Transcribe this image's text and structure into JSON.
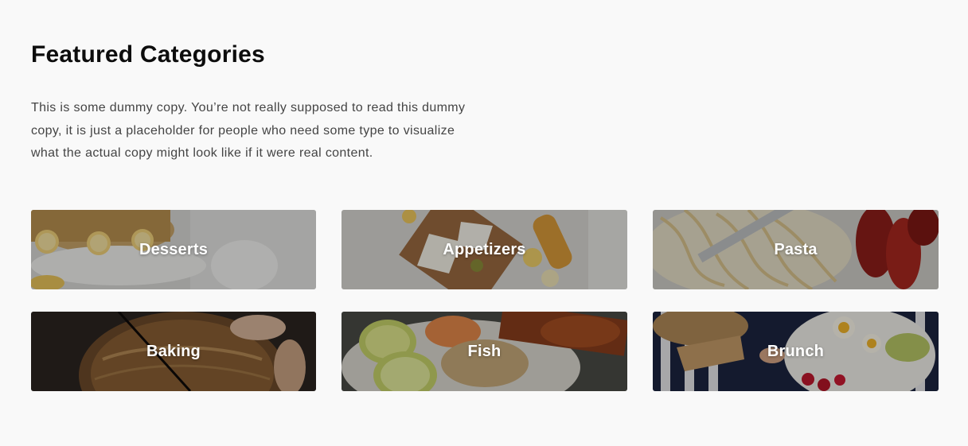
{
  "section": {
    "title": "Featured Categories",
    "intro": "This is some dummy copy. You’re not really supposed to read this dummy copy, it is just a placeholder for people who need some type to visualize what the actual copy might look like if it were real content."
  },
  "categories": [
    {
      "label": "Desserts",
      "image": "cake-with-lemons-photo"
    },
    {
      "label": "Appetizers",
      "image": "cheese-board-bread-photo"
    },
    {
      "label": "Pasta",
      "image": "spaghetti-crawfish-photo"
    },
    {
      "label": "Baking",
      "image": "bread-loaf-hands-photo"
    },
    {
      "label": "Fish",
      "image": "salmon-shrimp-lime-photo"
    },
    {
      "label": "Brunch",
      "image": "brunch-table-eggs-photo"
    }
  ],
  "colors": {
    "background": "#f9f9f9",
    "heading": "#0d0d0d",
    "body_text": "#444444",
    "card_label": "#ffffff"
  }
}
